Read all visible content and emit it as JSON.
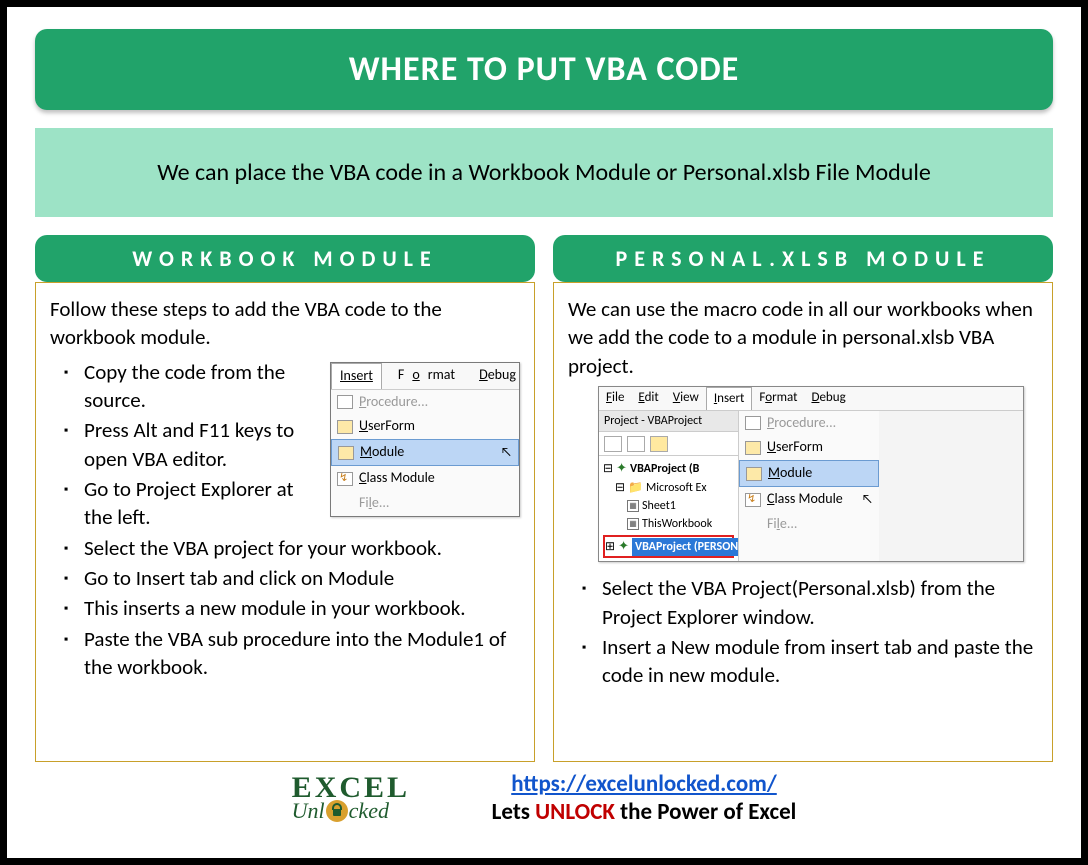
{
  "title": "WHERE TO PUT VBA CODE",
  "subtitle": "We can place the VBA code in a Workbook Module or Personal.xlsb File Module",
  "left": {
    "header": "WORKBOOK MODULE",
    "intro": "Follow these steps to add the VBA code to the workbook module.",
    "bullets": [
      "Copy the code from the source.",
      "Press Alt and F11 keys to open VBA editor.",
      "Go to Project Explorer at the left.",
      "Select the VBA project for your workbook.",
      "Go to Insert tab and click on Module",
      "This inserts a new module in your workbook.",
      "Paste the VBA sub procedure into the Module1 of the workbook."
    ],
    "menu": {
      "tabs": {
        "insert": "Insert",
        "format": "Format",
        "debug": "Debug"
      },
      "items": {
        "procedure": "Procedure...",
        "userform": "UserForm",
        "module": "Module",
        "classmodule": "Class Module",
        "file": "File..."
      }
    }
  },
  "right": {
    "header": "PERSONAL.XLSB MODULE",
    "intro": "We can use the macro code in all our workbooks when we add the code to a module in personal.xlsb VBA project.",
    "bullets": [
      "Select the VBA Project(Personal.xlsb) from the Project Explorer window.",
      "Insert a New module from insert tab and paste the code in new module."
    ],
    "vbe": {
      "menus": {
        "file": "File",
        "edit": "Edit",
        "view": "View",
        "insert": "Insert",
        "format": "Format",
        "debug": "Debug"
      },
      "panel_title": "Project - VBAProject",
      "tree": {
        "proj1": "VBAProject (B",
        "folder": "Microsoft Ex",
        "sheet1": "Sheet1",
        "thiswb": "ThisWorkbook",
        "proj2": "VBAProject (PERSONAL.XLSB)"
      },
      "drop": {
        "procedure": "Procedure...",
        "userform": "UserForm",
        "module": "Module",
        "classmodule": "Class Module",
        "file": "File..."
      }
    }
  },
  "footer": {
    "logo_top": "EXCEL",
    "logo_bottom_pre": "Unl",
    "logo_bottom_post": "cked",
    "url": "https://excelunlocked.com/",
    "tagline_pre": "Lets ",
    "tagline_unlock": "UNLOCK",
    "tagline_post": " the Power of Excel"
  }
}
